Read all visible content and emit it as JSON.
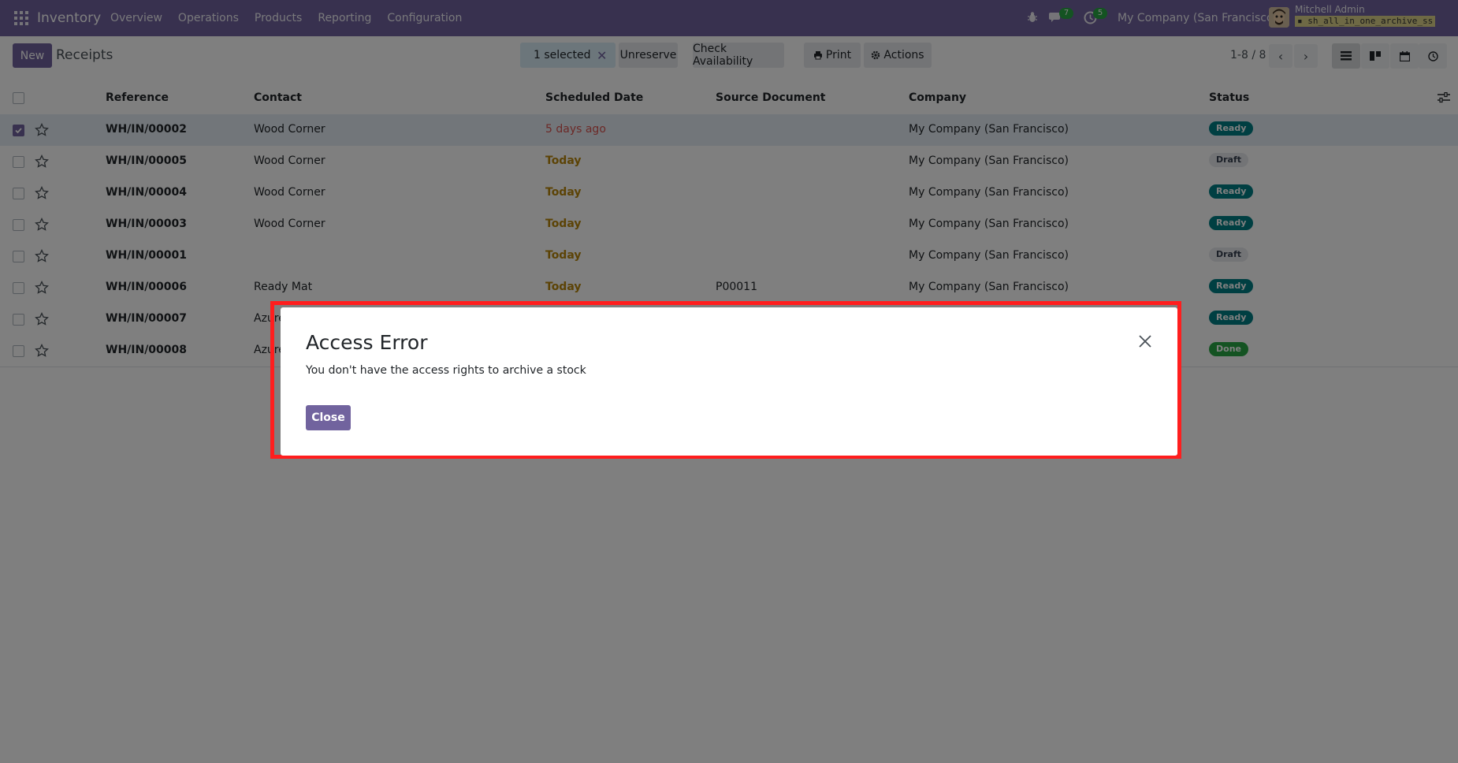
{
  "navbar": {
    "app_name": "Inventory",
    "menu": [
      "Overview",
      "Operations",
      "Products",
      "Reporting",
      "Configuration"
    ],
    "messages_count": "7",
    "activities_count": "5",
    "company": "My Company (San Francisco)",
    "user_name": "Mitchell Admin",
    "db_name": "sh_all_in_one_archive_ss"
  },
  "control": {
    "new_label": "New",
    "breadcrumb": "Receipts",
    "selected_label": "1 selected",
    "unreserve_label": "Unreserve",
    "check_availability_label": "Check Availability",
    "print_label": "Print",
    "actions_label": "Actions",
    "pager": "1-8 / 8"
  },
  "table": {
    "headers": [
      "Reference",
      "Contact",
      "Scheduled Date",
      "Source Document",
      "Company",
      "Status"
    ],
    "rows": [
      {
        "ref": "WH/IN/00002",
        "contact": "Wood Corner",
        "date": "5 days ago",
        "source": "",
        "company": "My Company (San Francisco)",
        "status": "Ready"
      },
      {
        "ref": "WH/IN/00005",
        "contact": "Wood Corner",
        "date": "Today",
        "source": "",
        "company": "My Company (San Francisco)",
        "status": "Draft"
      },
      {
        "ref": "WH/IN/00004",
        "contact": "Wood Corner",
        "date": "Today",
        "source": "",
        "company": "My Company (San Francisco)",
        "status": "Ready"
      },
      {
        "ref": "WH/IN/00003",
        "contact": "Wood Corner",
        "date": "Today",
        "source": "",
        "company": "My Company (San Francisco)",
        "status": "Ready"
      },
      {
        "ref": "WH/IN/00001",
        "contact": "",
        "date": "Today",
        "source": "",
        "company": "My Company (San Francisco)",
        "status": "Draft"
      },
      {
        "ref": "WH/IN/00006",
        "contact": "Ready Mat",
        "date": "Today",
        "source": "P00011",
        "company": "My Company (San Francisco)",
        "status": "Ready"
      },
      {
        "ref": "WH/IN/00007",
        "contact": "Azure",
        "date": "",
        "source": "",
        "company": "",
        "status": "Ready"
      },
      {
        "ref": "WH/IN/00008",
        "contact": "Azure",
        "date": "",
        "source": "",
        "company": "",
        "status": "Done"
      }
    ]
  },
  "dialog": {
    "title": "Access Error",
    "message": "You don't have the access rights to archive a stock",
    "close_label": "Close"
  },
  "colors": {
    "brand": "#71639e",
    "highlight": "#ff1e1e",
    "ready": "#017e84",
    "done": "#28a745"
  }
}
